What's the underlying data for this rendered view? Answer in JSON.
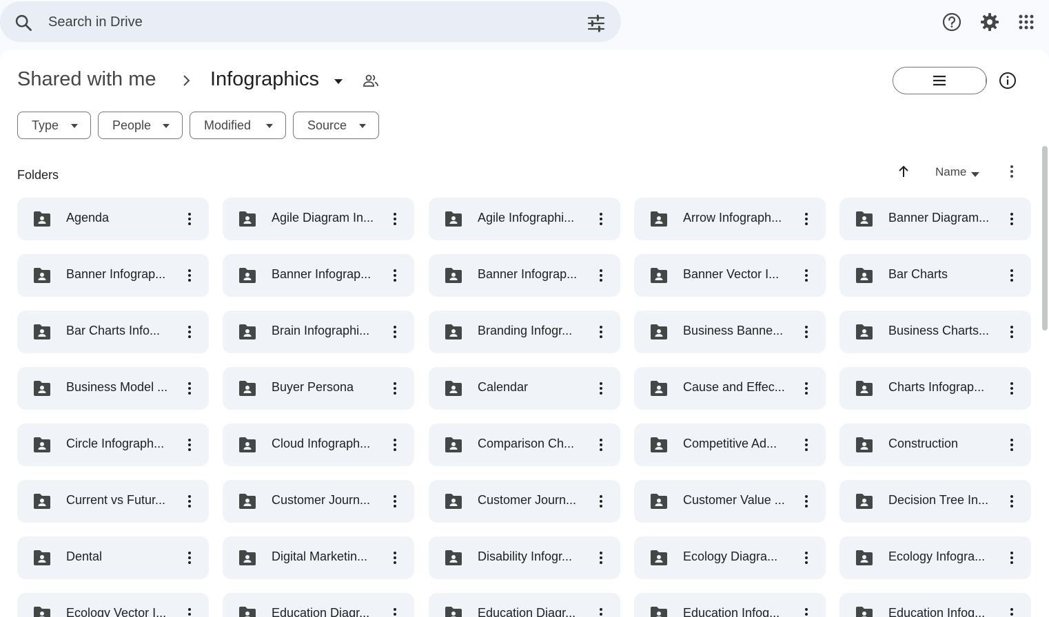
{
  "search": {
    "placeholder": "Search in Drive"
  },
  "topbar_icons": [
    "help-icon",
    "gear-icon",
    "apps-grid-icon"
  ],
  "breadcrumb": {
    "root": "Shared with me",
    "current": "Infographics"
  },
  "filters": [
    {
      "label": "Type"
    },
    {
      "label": "People"
    },
    {
      "label": "Modified"
    },
    {
      "label": "Source"
    }
  ],
  "view": {
    "selected": "grid"
  },
  "sections": {
    "folders_label": "Folders"
  },
  "sort": {
    "label": "Name",
    "direction": "ascending"
  },
  "folders": [
    "Agenda",
    "Agile Diagram In...",
    "Agile Infographi...",
    "Arrow Infograph...",
    "Banner Diagram...",
    "Banner Infograp...",
    "Banner Infograp...",
    "Banner Infograp...",
    "Banner Vector I...",
    "Bar Charts",
    "Bar Charts Info...",
    "Brain Infographi...",
    "Branding Infogr...",
    "Business Banne...",
    "Business Charts...",
    "Business Model ...",
    "Buyer Persona",
    "Calendar",
    "Cause and Effec...",
    "Charts Infograp...",
    "Circle Infograph...",
    "Cloud Infograph...",
    "Comparison Ch...",
    "Competitive Ad...",
    "Construction",
    "Current vs Futur...",
    "Customer Journ...",
    "Customer Journ...",
    "Customer Value ...",
    "Decision Tree In...",
    "Dental",
    "Digital Marketin...",
    "Disability Infogr...",
    "Ecology Diagra...",
    "Ecology Infogra...",
    "Ecology Vector I...",
    "Education Diagr...",
    "Education Diagr...",
    "Education Infog...",
    "Education Infog..."
  ],
  "colors": {
    "accent": "#c2e7ff",
    "tile_bg": "#f0f4f9",
    "search_bg": "#e9eef6"
  }
}
